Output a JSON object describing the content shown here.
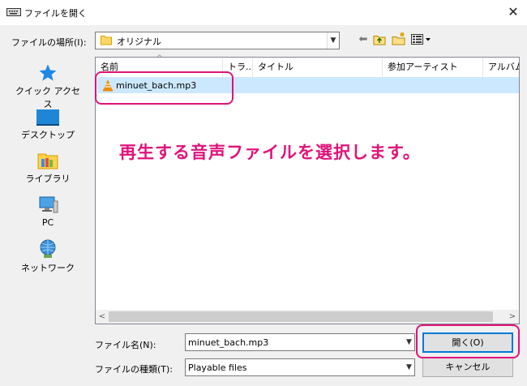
{
  "window": {
    "title": "ファイルを開く",
    "close_glyph": "✕"
  },
  "location": {
    "label": "ファイルの場所(I):",
    "value": "オリジナル",
    "dropdown_glyph": "▼"
  },
  "toolbar": {
    "back_glyph": "⬅"
  },
  "places": [
    {
      "label": "クイック アクセス",
      "icon": "star-icon"
    },
    {
      "label": "デスクトップ",
      "icon": "desktop-icon"
    },
    {
      "label": "ライブラリ",
      "icon": "library-icon"
    },
    {
      "label": "PC",
      "icon": "pc-icon"
    },
    {
      "label": "ネットワーク",
      "icon": "network-icon"
    }
  ],
  "list": {
    "sort_glyph": "^",
    "columns": [
      "名前",
      "トラ...",
      "タイトル",
      "参加アーティスト",
      "アルバム"
    ],
    "rows": [
      {
        "name": "minuet_bach.mp3",
        "icon": "vlc-cone-icon",
        "selected": true
      }
    ],
    "scroll_left": "<",
    "scroll_right": ">"
  },
  "annotation": {
    "text": "再生する音声ファイルを選択します。",
    "color": "#e0137a"
  },
  "filename": {
    "label": "ファイル名(N):",
    "value": "minuet_bach.mp3",
    "dropdown_glyph": "▼"
  },
  "filetype": {
    "label": "ファイルの種類(T):",
    "value": "Playable files",
    "dropdown_glyph": "▼"
  },
  "buttons": {
    "open": "開く(O)",
    "cancel": "キャンセル"
  },
  "colors": {
    "selection": "#cce8ff",
    "accent": "#0078d7"
  }
}
